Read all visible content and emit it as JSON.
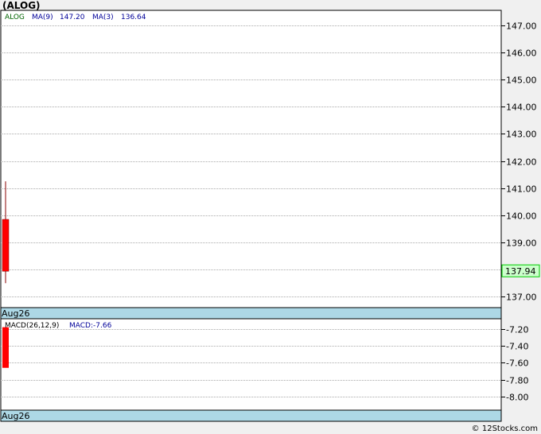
{
  "title": "(ALOG)",
  "watermark": "© 12Stocks.com",
  "colors": {
    "panel_bg": "#ffffff",
    "page_bg": "#f0f0f0",
    "grid": "#aaaaaa",
    "axis": "#000000",
    "up": "#00cc00",
    "down": "#ff0000",
    "wick": "#880000",
    "date_band": "#add8e6",
    "legend_symbol": "#006400",
    "legend_ma": "#000099",
    "price_tag_bg": "#ccffcc"
  },
  "chart_data": [
    {
      "type": "candlestick",
      "legend": {
        "symbol": "ALOG",
        "ma9_label": "MA(9)",
        "ma9_value": "147.20",
        "ma3_label": "MA(3)",
        "ma3_value": "136.64"
      },
      "ylim": [
        136.6,
        147.55
      ],
      "yticks": [
        147,
        146,
        145,
        144,
        143,
        142,
        141,
        140,
        139,
        138,
        137
      ],
      "ytick_labels": [
        "147.00",
        "146.00",
        "145.00",
        "144.00",
        "143.00",
        "142.00",
        "141.00",
        "140.00",
        "139.00",
        "138.00",
        "137.00"
      ],
      "candles": [
        {
          "date": "Aug26",
          "open": 139.85,
          "high": 141.25,
          "low": 137.5,
          "close": 137.94
        }
      ],
      "last_price": "137.94",
      "xlabel": "Aug26"
    },
    {
      "type": "bar",
      "legend": {
        "label": "MACD(26,12,9)",
        "value_label": "MACD:-7.66"
      },
      "ylim": [
        -8.16,
        -7.08
      ],
      "yticks": [
        -7.2,
        -7.4,
        -7.6,
        -7.8,
        -8.0
      ],
      "ytick_labels": [
        "-7.20",
        "-7.40",
        "-7.60",
        "-7.80",
        "-8.00"
      ],
      "bars": [
        {
          "date": "Aug26",
          "top": -7.18,
          "bottom": -7.66
        }
      ],
      "xlabel": "Aug26"
    }
  ]
}
